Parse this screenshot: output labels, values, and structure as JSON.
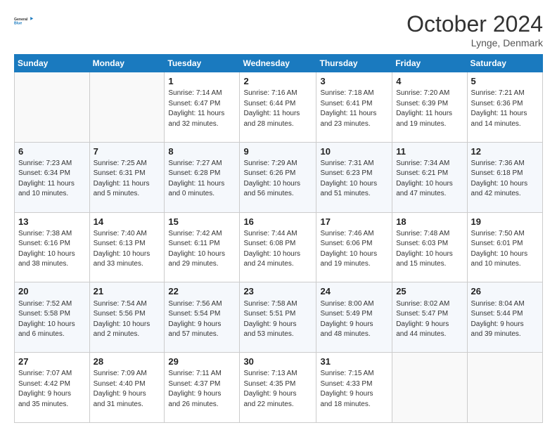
{
  "header": {
    "logo_line1": "General",
    "logo_line2": "Blue",
    "month": "October 2024",
    "location": "Lynge, Denmark"
  },
  "weekdays": [
    "Sunday",
    "Monday",
    "Tuesday",
    "Wednesday",
    "Thursday",
    "Friday",
    "Saturday"
  ],
  "weeks": [
    [
      {
        "day": "",
        "info": ""
      },
      {
        "day": "",
        "info": ""
      },
      {
        "day": "1",
        "info": "Sunrise: 7:14 AM\nSunset: 6:47 PM\nDaylight: 11 hours\nand 32 minutes."
      },
      {
        "day": "2",
        "info": "Sunrise: 7:16 AM\nSunset: 6:44 PM\nDaylight: 11 hours\nand 28 minutes."
      },
      {
        "day": "3",
        "info": "Sunrise: 7:18 AM\nSunset: 6:41 PM\nDaylight: 11 hours\nand 23 minutes."
      },
      {
        "day": "4",
        "info": "Sunrise: 7:20 AM\nSunset: 6:39 PM\nDaylight: 11 hours\nand 19 minutes."
      },
      {
        "day": "5",
        "info": "Sunrise: 7:21 AM\nSunset: 6:36 PM\nDaylight: 11 hours\nand 14 minutes."
      }
    ],
    [
      {
        "day": "6",
        "info": "Sunrise: 7:23 AM\nSunset: 6:34 PM\nDaylight: 11 hours\nand 10 minutes."
      },
      {
        "day": "7",
        "info": "Sunrise: 7:25 AM\nSunset: 6:31 PM\nDaylight: 11 hours\nand 5 minutes."
      },
      {
        "day": "8",
        "info": "Sunrise: 7:27 AM\nSunset: 6:28 PM\nDaylight: 11 hours\nand 0 minutes."
      },
      {
        "day": "9",
        "info": "Sunrise: 7:29 AM\nSunset: 6:26 PM\nDaylight: 10 hours\nand 56 minutes."
      },
      {
        "day": "10",
        "info": "Sunrise: 7:31 AM\nSunset: 6:23 PM\nDaylight: 10 hours\nand 51 minutes."
      },
      {
        "day": "11",
        "info": "Sunrise: 7:34 AM\nSunset: 6:21 PM\nDaylight: 10 hours\nand 47 minutes."
      },
      {
        "day": "12",
        "info": "Sunrise: 7:36 AM\nSunset: 6:18 PM\nDaylight: 10 hours\nand 42 minutes."
      }
    ],
    [
      {
        "day": "13",
        "info": "Sunrise: 7:38 AM\nSunset: 6:16 PM\nDaylight: 10 hours\nand 38 minutes."
      },
      {
        "day": "14",
        "info": "Sunrise: 7:40 AM\nSunset: 6:13 PM\nDaylight: 10 hours\nand 33 minutes."
      },
      {
        "day": "15",
        "info": "Sunrise: 7:42 AM\nSunset: 6:11 PM\nDaylight: 10 hours\nand 29 minutes."
      },
      {
        "day": "16",
        "info": "Sunrise: 7:44 AM\nSunset: 6:08 PM\nDaylight: 10 hours\nand 24 minutes."
      },
      {
        "day": "17",
        "info": "Sunrise: 7:46 AM\nSunset: 6:06 PM\nDaylight: 10 hours\nand 19 minutes."
      },
      {
        "day": "18",
        "info": "Sunrise: 7:48 AM\nSunset: 6:03 PM\nDaylight: 10 hours\nand 15 minutes."
      },
      {
        "day": "19",
        "info": "Sunrise: 7:50 AM\nSunset: 6:01 PM\nDaylight: 10 hours\nand 10 minutes."
      }
    ],
    [
      {
        "day": "20",
        "info": "Sunrise: 7:52 AM\nSunset: 5:58 PM\nDaylight: 10 hours\nand 6 minutes."
      },
      {
        "day": "21",
        "info": "Sunrise: 7:54 AM\nSunset: 5:56 PM\nDaylight: 10 hours\nand 2 minutes."
      },
      {
        "day": "22",
        "info": "Sunrise: 7:56 AM\nSunset: 5:54 PM\nDaylight: 9 hours\nand 57 minutes."
      },
      {
        "day": "23",
        "info": "Sunrise: 7:58 AM\nSunset: 5:51 PM\nDaylight: 9 hours\nand 53 minutes."
      },
      {
        "day": "24",
        "info": "Sunrise: 8:00 AM\nSunset: 5:49 PM\nDaylight: 9 hours\nand 48 minutes."
      },
      {
        "day": "25",
        "info": "Sunrise: 8:02 AM\nSunset: 5:47 PM\nDaylight: 9 hours\nand 44 minutes."
      },
      {
        "day": "26",
        "info": "Sunrise: 8:04 AM\nSunset: 5:44 PM\nDaylight: 9 hours\nand 39 minutes."
      }
    ],
    [
      {
        "day": "27",
        "info": "Sunrise: 7:07 AM\nSunset: 4:42 PM\nDaylight: 9 hours\nand 35 minutes."
      },
      {
        "day": "28",
        "info": "Sunrise: 7:09 AM\nSunset: 4:40 PM\nDaylight: 9 hours\nand 31 minutes."
      },
      {
        "day": "29",
        "info": "Sunrise: 7:11 AM\nSunset: 4:37 PM\nDaylight: 9 hours\nand 26 minutes."
      },
      {
        "day": "30",
        "info": "Sunrise: 7:13 AM\nSunset: 4:35 PM\nDaylight: 9 hours\nand 22 minutes."
      },
      {
        "day": "31",
        "info": "Sunrise: 7:15 AM\nSunset: 4:33 PM\nDaylight: 9 hours\nand 18 minutes."
      },
      {
        "day": "",
        "info": ""
      },
      {
        "day": "",
        "info": ""
      }
    ]
  ]
}
